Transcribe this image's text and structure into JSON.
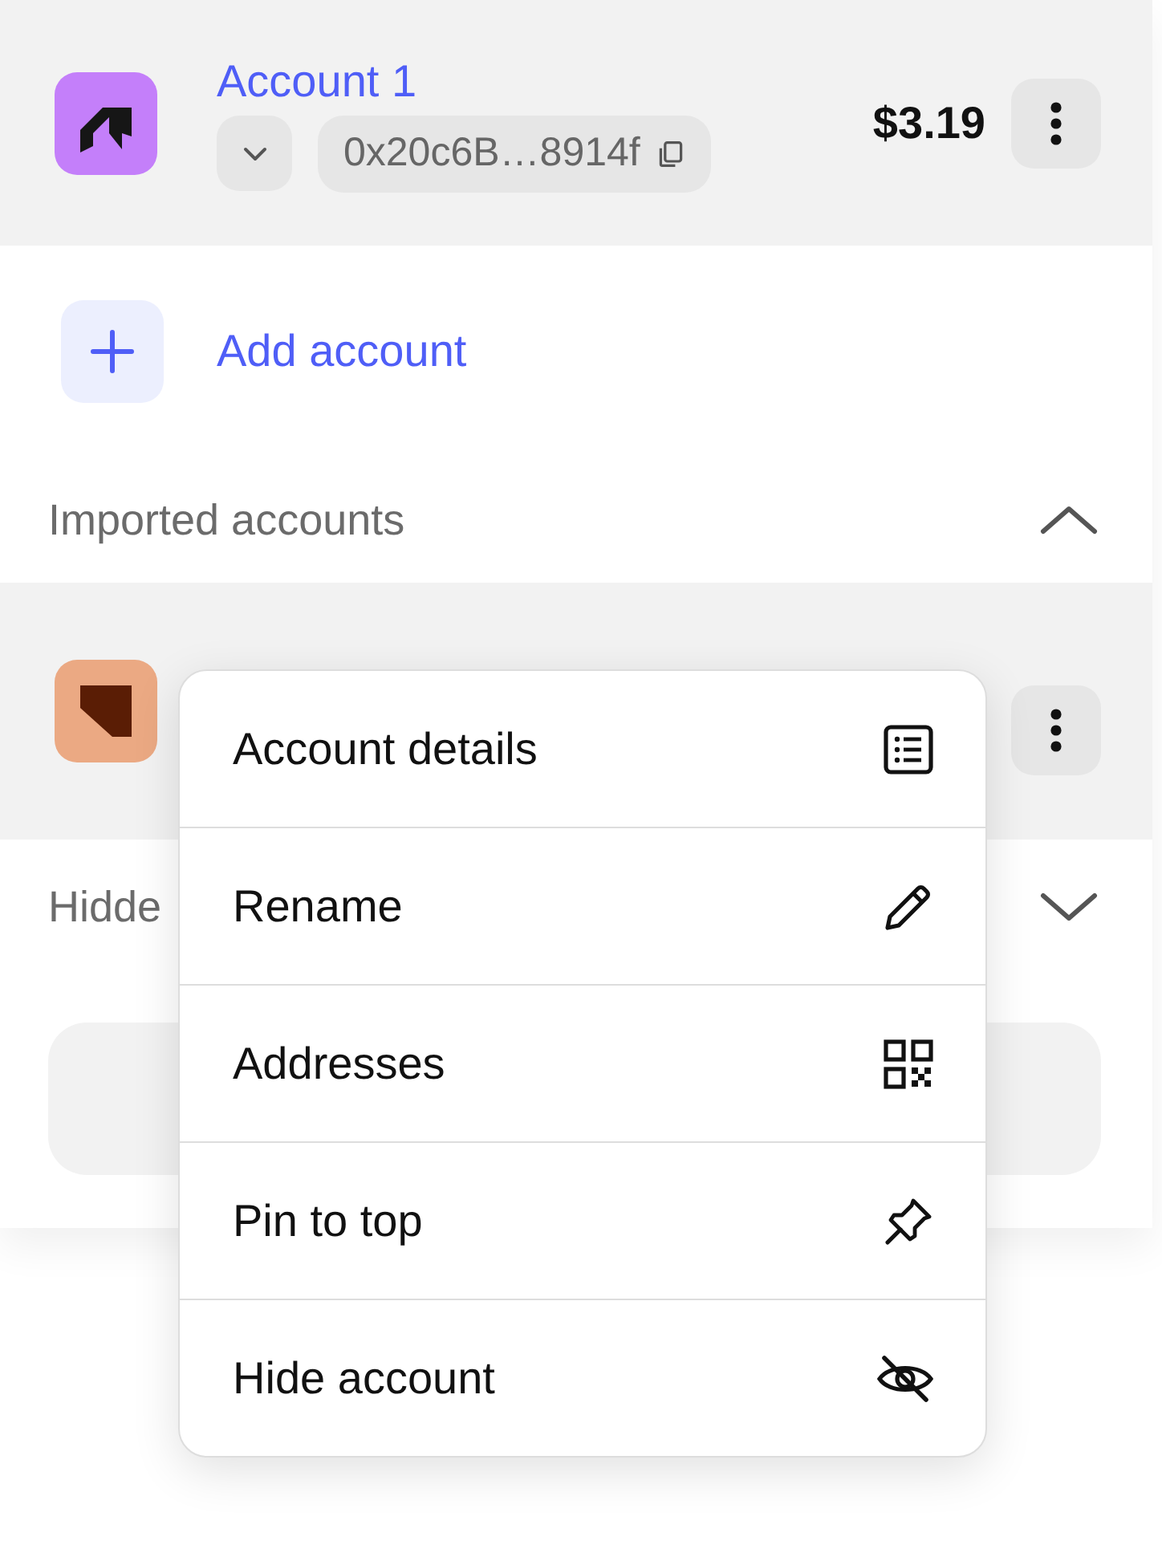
{
  "current_account": {
    "name": "Account 1",
    "address": "0x20c6B…8914f",
    "balance": "$3.19"
  },
  "add_account": {
    "label": "Add account"
  },
  "imported_section": {
    "title": "Imported accounts",
    "expanded": true
  },
  "hidden_section": {
    "title": "Hidde",
    "expanded": false
  },
  "context_menu": {
    "items": [
      {
        "label": "Account details",
        "kind": "details"
      },
      {
        "label": "Rename",
        "kind": "rename"
      },
      {
        "label": "Addresses",
        "kind": "addresses"
      },
      {
        "label": "Pin to top",
        "kind": "pin"
      },
      {
        "label": "Hide account",
        "kind": "hide"
      }
    ]
  }
}
